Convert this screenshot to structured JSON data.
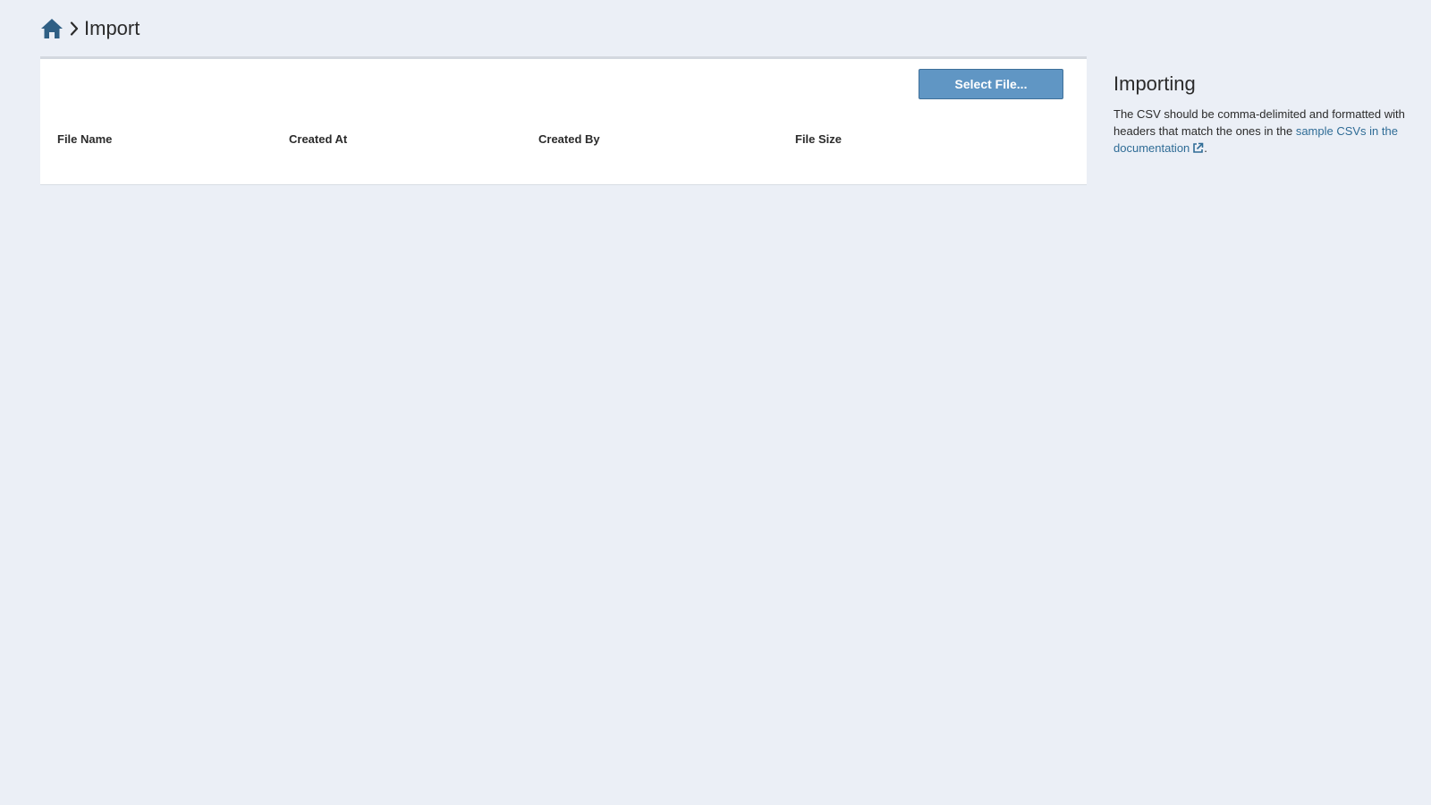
{
  "breadcrumb": {
    "home_icon": "home-icon",
    "separator_icon": "chevron-right-icon",
    "current": "Import"
  },
  "toolbar": {
    "select_file_label": "Select File..."
  },
  "table": {
    "columns": [
      "File Name",
      "Created At",
      "Created By",
      "File Size"
    ],
    "rows": []
  },
  "sidebar": {
    "title": "Importing",
    "text_before_link": "The CSV should be comma-delimited and formatted with headers that match the ones in the ",
    "link_text": "sample CSVs in the documentation",
    "text_after_link": ".",
    "link_icon": "external-link-icon"
  },
  "colors": {
    "background": "#ebeff6",
    "button": "#6096c4",
    "link": "#2f6c96",
    "home_icon": "#2f5f84"
  }
}
